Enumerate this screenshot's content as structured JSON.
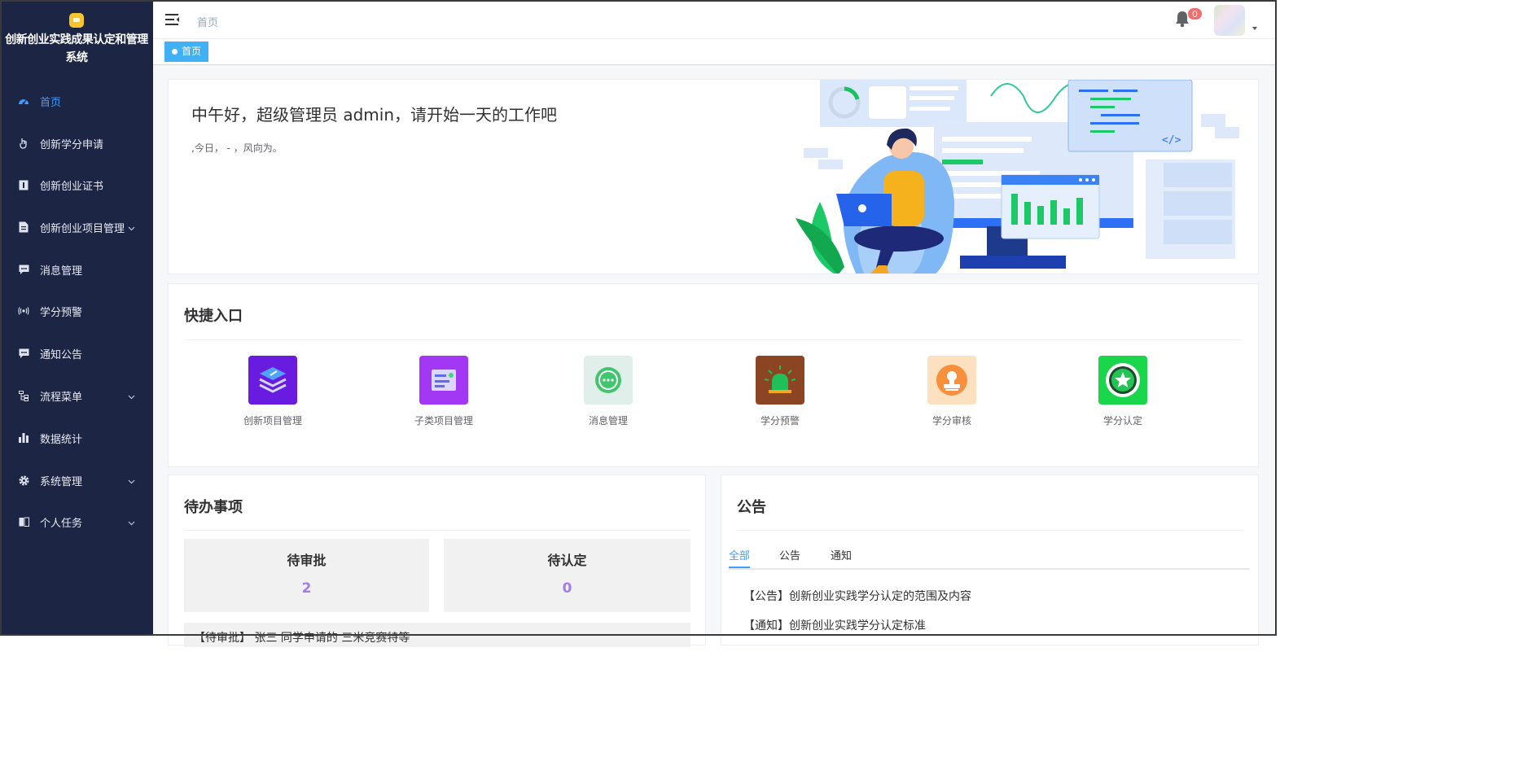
{
  "sidebar": {
    "title": "创新创业实践成果认定和管理系统",
    "items": [
      {
        "label": "首页",
        "icon": "dashboard-icon",
        "active": true
      },
      {
        "label": "创新学分申请",
        "icon": "hand-pointer-icon"
      },
      {
        "label": "创新创业证书",
        "icon": "certificate-icon"
      },
      {
        "label": "创新创业项目管理",
        "icon": "document-icon",
        "expandable": true
      },
      {
        "label": "消息管理",
        "icon": "chat-icon"
      },
      {
        "label": "学分预警",
        "icon": "broadcast-icon"
      },
      {
        "label": "通知公告",
        "icon": "chat-icon"
      },
      {
        "label": "流程菜单",
        "icon": "tree-icon",
        "expandable": true
      },
      {
        "label": "数据统计",
        "icon": "bar-chart-icon"
      },
      {
        "label": "系统管理",
        "icon": "gear-icon",
        "expandable": true
      },
      {
        "label": "个人任务",
        "icon": "book-icon",
        "expandable": true
      }
    ]
  },
  "header": {
    "breadcrumb": "首页",
    "notification_count": "0"
  },
  "tags": {
    "active_tag": "首页"
  },
  "welcome": {
    "greeting": "中午好，超级管理员 admin，请开始一天的工作吧",
    "subline": ",今日， - ，风向为。"
  },
  "quick_entry": {
    "title": "快捷入口",
    "items": [
      {
        "label": "创新项目管理",
        "icon": "layers-icon",
        "color": "#6a1be0"
      },
      {
        "label": "子类项目管理",
        "icon": "board-icon",
        "color": "#a238f3"
      },
      {
        "label": "消息管理",
        "icon": "message-bubble-icon",
        "color": "#e0efe9"
      },
      {
        "label": "学分预警",
        "icon": "alarm-light-icon",
        "color": "#8c4523"
      },
      {
        "label": "学分审核",
        "icon": "stamp-icon",
        "color": "#fde0bf"
      },
      {
        "label": "学分认定",
        "icon": "star-badge-icon",
        "color": "#19d64b"
      }
    ]
  },
  "todo": {
    "title": "待办事项",
    "pending_approval_label": "待审批",
    "pending_approval_count": "2",
    "pending_certify_label": "待认定",
    "pending_certify_count": "0",
    "first_row": "【待审批】 张三 同学申请的 三米竞赛特等"
  },
  "notice": {
    "title": "公告",
    "tabs": [
      "全部",
      "公告",
      "通知"
    ],
    "active_tab": "全部",
    "items": [
      "【公告】创新创业实践学分认定的范围及内容",
      "【通知】创新创业实践学分认定标准"
    ]
  },
  "colors": {
    "sidebar_bg": "#1c2544",
    "accent": "#409eff",
    "tag_bg": "#42b0f5",
    "stat_value": "#a180e6",
    "badge": "#f56c6c"
  }
}
